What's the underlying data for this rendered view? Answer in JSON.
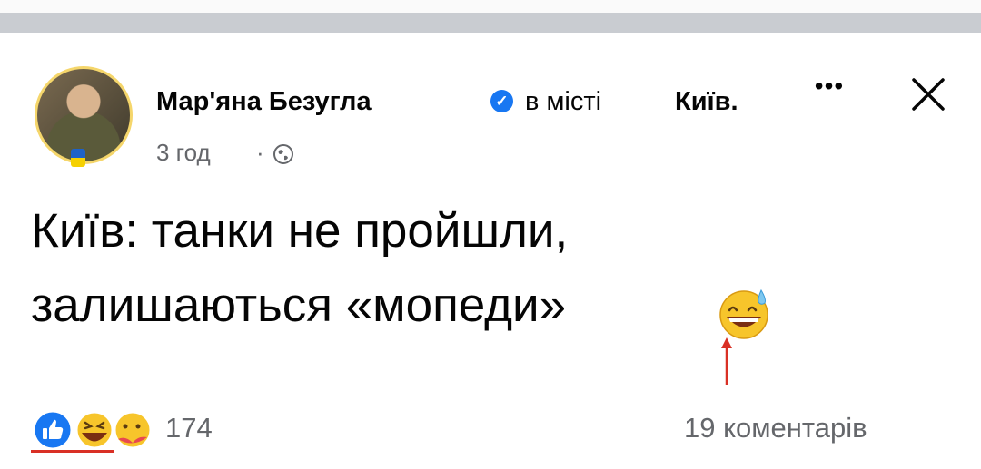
{
  "post": {
    "author": "Мар'яна Безугла",
    "location_prefix": "в місті",
    "location": "Київ.",
    "time": "3 год",
    "separator": "·",
    "text_line1": "Київ: танки не пройшли,",
    "text_line2": "залишаються «мопеди»"
  },
  "actions": {
    "more": "•••"
  },
  "footer": {
    "reaction_count": "174",
    "comments": "19 коментарів"
  },
  "icons": {
    "verified": "verified-badge-icon",
    "globe": "globe-icon",
    "close": "close-icon",
    "emoji": "grinning-sweat-emoji",
    "reactions": [
      "like-icon",
      "laughing-icon",
      "care-icon"
    ]
  },
  "colors": {
    "facebook_blue": "#1877f2",
    "secondary_text": "#65676b",
    "annotation_red": "#d93025"
  }
}
